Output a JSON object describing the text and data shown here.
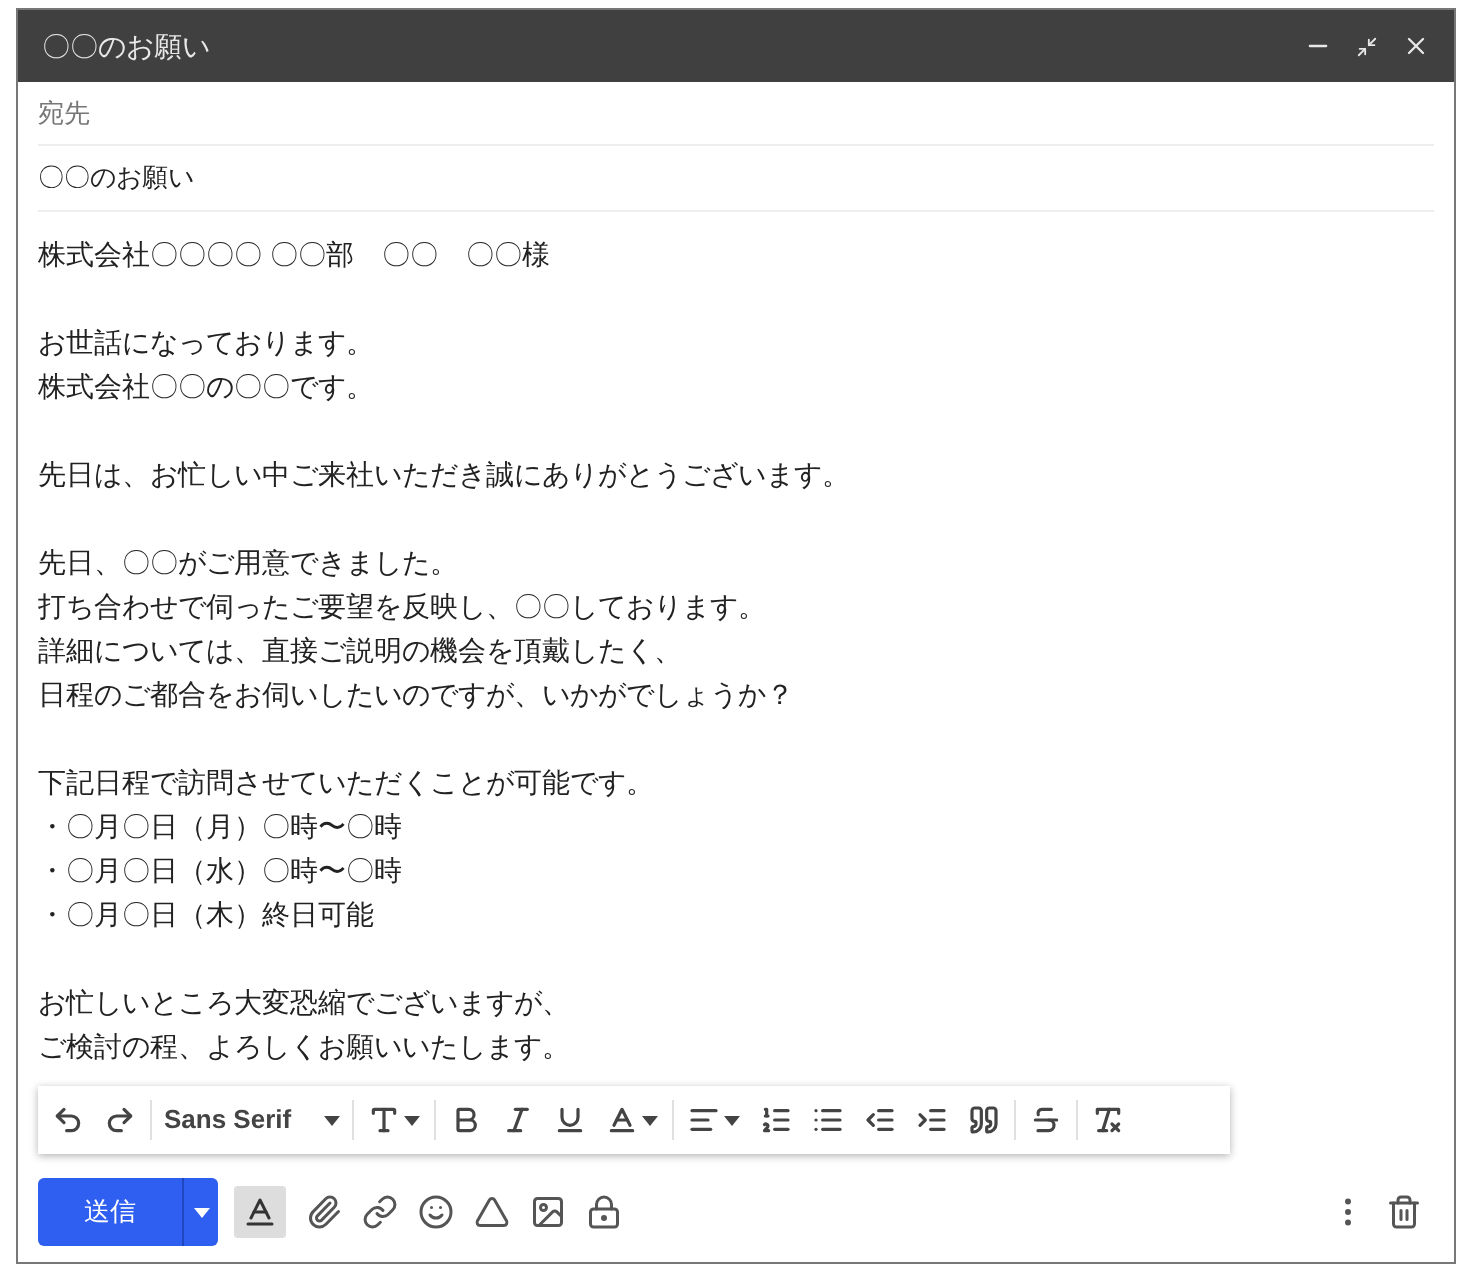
{
  "window": {
    "title": "〇〇のお願い"
  },
  "to_field": {
    "placeholder": "宛先"
  },
  "subject": {
    "value": "〇〇のお願い"
  },
  "body": {
    "paragraphs": [
      [
        "株式会社〇〇〇〇 〇〇部　〇〇　〇〇様"
      ],
      [
        "お世話になっております。",
        "株式会社〇〇の〇〇です。"
      ],
      [
        "先日は、お忙しい中ご来社いただき誠にありがとうございます。"
      ],
      [
        "先日、〇〇がご用意できました。",
        "打ち合わせで伺ったご要望を反映し、〇〇しております。",
        "詳細については、直接ご説明の機会を頂戴したく、",
        "日程のご都合をお伺いしたいのですが、いかがでしょうか？"
      ],
      [
        "下記日程で訪問させていただくことが可能です。",
        "・〇月〇日（月）〇時〜〇時",
        "・〇月〇日（水）〇時〜〇時",
        "・〇月〇日（木）終日可能"
      ],
      [
        "お忙しいところ大変恐縮でございますが、",
        "ご検討の程、よろしくお願いいたします。"
      ]
    ]
  },
  "format_toolbar": {
    "font": "Sans Serif"
  },
  "send_button": {
    "label": "送信"
  },
  "formatting_toggle": {
    "selected": true
  }
}
